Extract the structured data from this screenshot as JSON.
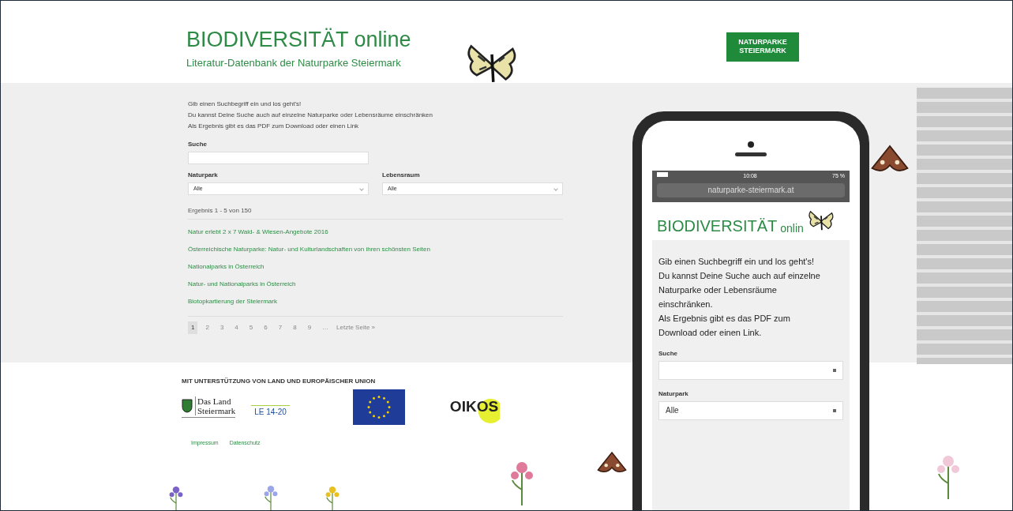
{
  "header": {
    "title": "BIODIVERSITÄT online",
    "subtitle": "Literatur-Datenbank der Naturparke Steiermark",
    "logo_lines": [
      "NATURPARKE",
      "STEIERMARK"
    ]
  },
  "search": {
    "intro": [
      "Gib einen Suchbegriff ein und los geht's!",
      "Du kannst Deine Suche auch auf einzelne Naturparke oder Lebensräume einschränken",
      "Als Ergebnis gibt es das PDF zum Download oder einen Link"
    ],
    "fields": [
      {
        "label": "Suche",
        "kind": "text"
      },
      {
        "label": "Naturpark",
        "kind": "select",
        "value": "Alle"
      },
      {
        "label": "Lebensraum",
        "kind": "select",
        "value": "Alle"
      }
    ]
  },
  "results": {
    "summary": "Ergebnis 1 - 5 von 150",
    "items": [
      "Natur erlebt 2 x 7 Wald- & Wiesen-Angebote 2016",
      "Österreichische Naturparke: Natur- und Kulturlandschaften von ihren schönsten Seiten",
      "Nationalparks in Österreich",
      "Natur- und Nationalparks in Österreich",
      "Biotopkartierung der Steiermark"
    ],
    "pages": [
      {
        "label": "1",
        "selected": true
      },
      {
        "label": "2",
        "selected": false
      },
      {
        "label": "3",
        "selected": false
      },
      {
        "label": "4",
        "selected": false
      },
      {
        "label": "5",
        "selected": false
      },
      {
        "label": "6",
        "selected": false
      },
      {
        "label": "7",
        "selected": false
      },
      {
        "label": "8",
        "selected": false
      },
      {
        "label": "9",
        "selected": false
      }
    ],
    "ellipsis": "…",
    "last": "Letzte Seite »"
  },
  "footer": {
    "support_text": "MIT UNTERSTÜTZUNG VON LAND UND EUROPÄISCHER UNION",
    "land_logo_lines": [
      "Das Land",
      "Steiermark"
    ],
    "le_logo": "LE 14-20",
    "oikos": "OIKOS",
    "links": [
      "Impressum",
      "Datenschutz"
    ]
  },
  "phone": {
    "time": "10:08",
    "battery": "75 %",
    "url": "naturparke-steiermark.at",
    "title": "BIODIVERSITÄT",
    "title_suffix": "onlin",
    "intro": [
      "Gib einen Suchbegriff ein und los geht's!",
      "Du kannst Deine Suche auch auf einzelne",
      "Naturparke oder Lebensräume",
      "einschränken.",
      "Als Ergebnis gibt es das PDF zum",
      "Download oder einen Link."
    ],
    "fields": [
      {
        "label": "Suche",
        "kind": "select"
      },
      {
        "label": "Naturpark",
        "kind": "select",
        "value": "Alle"
      }
    ]
  }
}
